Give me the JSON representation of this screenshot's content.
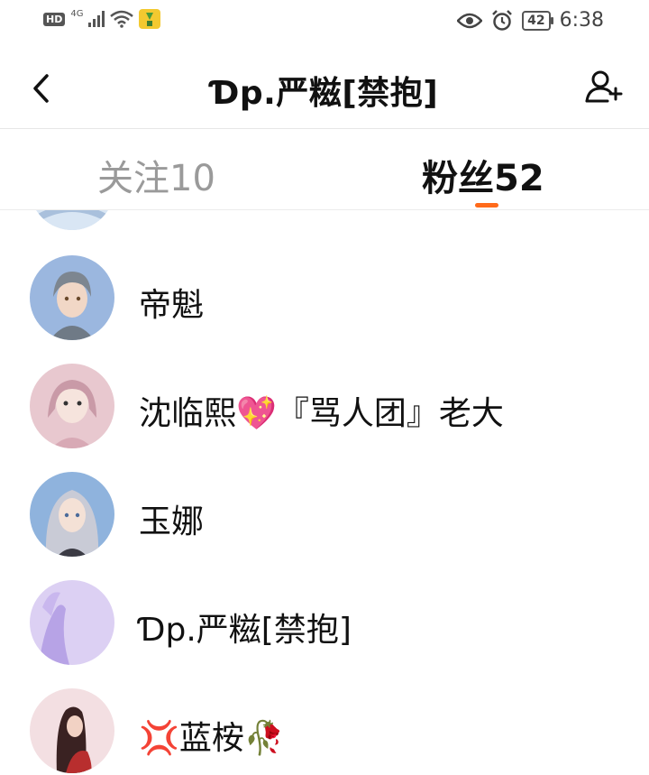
{
  "status_bar": {
    "hd_badge": "HD",
    "network": "4G",
    "battery": "42",
    "time": "6:38"
  },
  "header": {
    "title": "Ɗp.严糍[禁抱]",
    "back_icon": "chevron-left-icon",
    "add_icon": "add-user-icon"
  },
  "tabs": [
    {
      "label": "关注10",
      "active": false
    },
    {
      "label": "粉丝52",
      "active": true
    }
  ],
  "accent_color": "#ff6a1a",
  "followers": [
    {
      "name": "",
      "avatar_color": "#c7d9ee"
    },
    {
      "name": "帝魁",
      "avatar_color": "#9bb7df"
    },
    {
      "name": "沈临熙💖『骂人团』老大",
      "avatar_color": "#e8c8cf"
    },
    {
      "name": "玉娜",
      "avatar_color": "#8fb3dd"
    },
    {
      "name": "Ɗp.严糍[禁抱]",
      "avatar_color": "#d8c9f1"
    },
    {
      "name": "💢蓝桉🥀",
      "avatar_color": "#f3dfe2"
    }
  ]
}
